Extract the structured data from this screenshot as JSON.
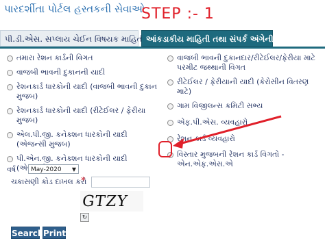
{
  "header": {
    "title": "પારદર્શીતા પોર્ટલ હસ્તકની સેવાઓ",
    "step": "STEP :- 1"
  },
  "tabs": [
    {
      "label": "પી.ડી.એસ. સપ્લાય ચેઈન વિષયક માહિતી",
      "active": false
    },
    {
      "label": "આંકડાકીય માહિતી તથા સંપર્ક અંગેની",
      "active": true
    }
  ],
  "left_items": [
    {
      "label": "તમારા રેશન કાર્ડની વિગત"
    },
    {
      "label": "વાજબી ભાવની દુકાનની યાદી"
    },
    {
      "label": "રેશનકાર્ડ ધારકોની યાદી (વાજબી ભાવની દુકાન મુજબ)"
    },
    {
      "label": "રેશનકાર્ડ ધારકોની યાદી (રીટેઈલર / ફેરીયા મુજબ)"
    },
    {
      "label": "એલ.પી.જી. કનેક્શન ધારકોની યાદી (એજન્સી મુજબ)"
    },
    {
      "label": "પી.એન.જી. કનેક્શન ધારકોની યાદી (એજન્સી મુજબ)"
    }
  ],
  "right_items": [
    {
      "label": "વાજબી ભાવની દુકાનદાર/રીટેઈલર/ફેરીયા માટે પરમીટ જથ્થાની વિગત"
    },
    {
      "label": "રીટેઈલર / ફેરીયાની યાદી (કેરોસીન વિતરણ માટે)"
    },
    {
      "label": "ગામ વિજીલન્સ કમિટી સભ્ય"
    },
    {
      "label": "એફ.પી.એસ. વ્યવહારો"
    },
    {
      "label": "રેશન કાર્ડ વ્યવહારો"
    },
    {
      "label": "વિસ્તાર મુજબની રેશન કાર્ડ વિગતો - એન.એફ.એસ.એ"
    }
  ],
  "form": {
    "year_label": "વર્ષ",
    "year_value": "May-2020",
    "captcha_label": "ચકાસણી કોડ દાખલ કરો",
    "required_mark": "*",
    "captcha_text": "GTZY",
    "refresh_symbol": "↻",
    "search_label": "Search",
    "print_label": "Print"
  },
  "colors": {
    "tab_active": "#1e6a7e",
    "step_red": "#e0202a",
    "title_blue": "#2a6fb0",
    "button": "#2f5f8c"
  }
}
